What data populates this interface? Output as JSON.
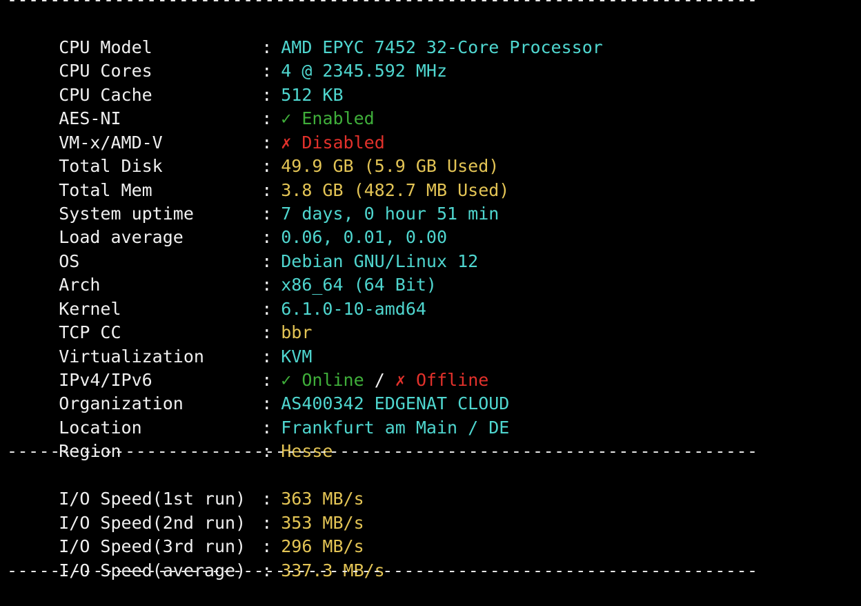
{
  "separator": "----------------------------------------------------------------------",
  "system_info": [
    {
      "label": "CPU Model",
      "value": "AMD EPYC 7452 32-Core Processor",
      "color": "cyan"
    },
    {
      "label": "CPU Cores",
      "value": "4 @ 2345.592 MHz",
      "color": "cyan"
    },
    {
      "label": "CPU Cache",
      "value": "512 KB",
      "color": "cyan"
    },
    {
      "label": "AES-NI",
      "mark": "✓",
      "value": "Enabled",
      "color": "green"
    },
    {
      "label": "VM-x/AMD-V",
      "mark": "✗",
      "value": "Disabled",
      "color": "red"
    },
    {
      "label": "Total Disk",
      "value": "49.9 GB (5.9 GB Used)",
      "color": "yellow"
    },
    {
      "label": "Total Mem",
      "value": "3.8 GB (482.7 MB Used)",
      "color": "yellow"
    },
    {
      "label": "System uptime",
      "value": "7 days, 0 hour 51 min",
      "color": "cyan"
    },
    {
      "label": "Load average",
      "value": "0.06, 0.01, 0.00",
      "color": "cyan"
    },
    {
      "label": "OS",
      "value": "Debian GNU/Linux 12",
      "color": "cyan"
    },
    {
      "label": "Arch",
      "value": "x86_64 (64 Bit)",
      "color": "cyan"
    },
    {
      "label": "Kernel",
      "value": "6.1.0-10-amd64",
      "color": "cyan"
    },
    {
      "label": "TCP CC",
      "value": "bbr",
      "color": "yellow"
    },
    {
      "label": "Virtualization",
      "value": "KVM",
      "color": "cyan"
    }
  ],
  "ip_row": {
    "label": "IPv4/IPv6",
    "v4_mark": "✓",
    "v4_status": "Online",
    "divider": "/",
    "v6_mark": "✗",
    "v6_status": "Offline"
  },
  "network_info": [
    {
      "label": "Organization",
      "value": "AS400342 EDGENAT CLOUD",
      "color": "cyan"
    },
    {
      "label": "Location",
      "value": "Frankfurt am Main / DE",
      "color": "cyan"
    },
    {
      "label": "Region",
      "value": "Hesse",
      "color": "yellow"
    }
  ],
  "io_speed": [
    {
      "label": "I/O Speed(1st run)",
      "value": "363 MB/s"
    },
    {
      "label": "I/O Speed(2nd run)",
      "value": "353 MB/s"
    },
    {
      "label": "I/O Speed(3rd run)",
      "value": "296 MB/s"
    },
    {
      "label": "I/O Speed(average)",
      "value": "337.3 MB/s"
    }
  ],
  "colors": {
    "background": "#000000",
    "label": "#f0f0f0",
    "cyan": "#4fd6cf",
    "yellow": "#e3c455",
    "green": "#3fae3a",
    "red": "#e2312b"
  }
}
